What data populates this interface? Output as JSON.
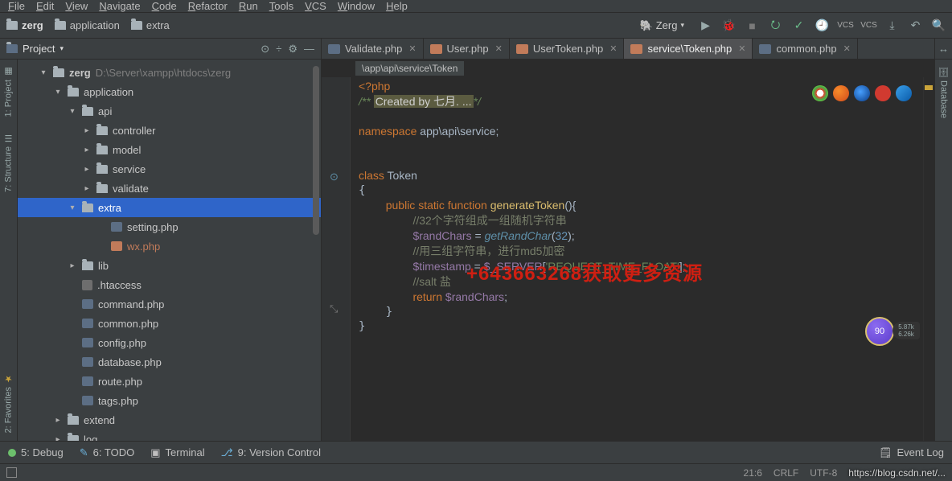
{
  "menu": {
    "items": [
      "File",
      "Edit",
      "View",
      "Navigate",
      "Code",
      "Refactor",
      "Run",
      "Tools",
      "VCS",
      "Window",
      "Help"
    ]
  },
  "path": {
    "root": "zerg",
    "p1": "application",
    "p2": "extra"
  },
  "runTarget": "Zerg",
  "projectLabel": "Project",
  "tabs": [
    {
      "label": "Validate.php",
      "active": false,
      "orange": false
    },
    {
      "label": "User.php",
      "active": false,
      "orange": true
    },
    {
      "label": "UserToken.php",
      "active": false,
      "orange": true
    },
    {
      "label": "service\\Token.php",
      "active": true,
      "orange": true
    },
    {
      "label": "common.php",
      "active": false,
      "orange": false
    }
  ],
  "tree": {
    "root": "zerg",
    "rootPath": "D:\\Server\\xampp\\htdocs\\zerg",
    "app": "application",
    "api": "api",
    "apiChildren": [
      "controller",
      "model",
      "service",
      "validate"
    ],
    "extra": "extra",
    "extraChildren": [
      "setting.php",
      "wx.php"
    ],
    "lib": "lib",
    "rootFiles": [
      ".htaccess",
      "command.php",
      "common.php",
      "config.php",
      "database.php",
      "route.php",
      "tags.php"
    ],
    "extend": "extend",
    "log": "log"
  },
  "breadcrumb": "\\app\\api\\service\\Token",
  "code": {
    "openTag": "<?php",
    "docPrefix": "/** ",
    "docHighlight": "Created by 七月. ...",
    "docSuffix": "*/",
    "nsKw": "namespace ",
    "ns": "app\\api\\service;",
    "classKw": "class ",
    "cls": "Token",
    "pubKw": "public ",
    "statKw": "static ",
    "funcKw": "function ",
    "method": "generateToken",
    "paren": "(){",
    "c1": "//32个字符组成一组随机字符串",
    "l1a": "$randChars",
    "l1b": " = ",
    "l1c": "getRandChar",
    "l1d": "(",
    "l1e": "32",
    "l1f": ");",
    "c2": "//用三组字符串，进行md5加密",
    "l2a": "$timestamp",
    "l2b": " = ",
    "l2c": "$_SERVER",
    "l2d": "[",
    "l2e": "'REQUEST_TIME_FLOAT'",
    "l2f": "];",
    "c3": "//salt 盐",
    "retKw": "return ",
    "retVar": "$randChars",
    "retEnd": ";"
  },
  "overlay": "+643663268获取更多资源",
  "bubble": "90",
  "bubbleTag1": "5.87k",
  "bubbleTag2": "6.26k",
  "sideLeft": {
    "s1": "1: Project",
    "s2": "7: Structure",
    "s3": "2: Favorites"
  },
  "sideRight": {
    "s1": "Database"
  },
  "toolStrip": {
    "debug": "5: Debug",
    "todo": "6: TODO",
    "terminal": "Terminal",
    "vc": "9: Version Control",
    "eventLog": "Event Log"
  },
  "status": {
    "pos": "21:6",
    "crlf": "CRLF",
    "enc": "UTF-8",
    "watermark": "https://blog.csdn.net/..."
  }
}
